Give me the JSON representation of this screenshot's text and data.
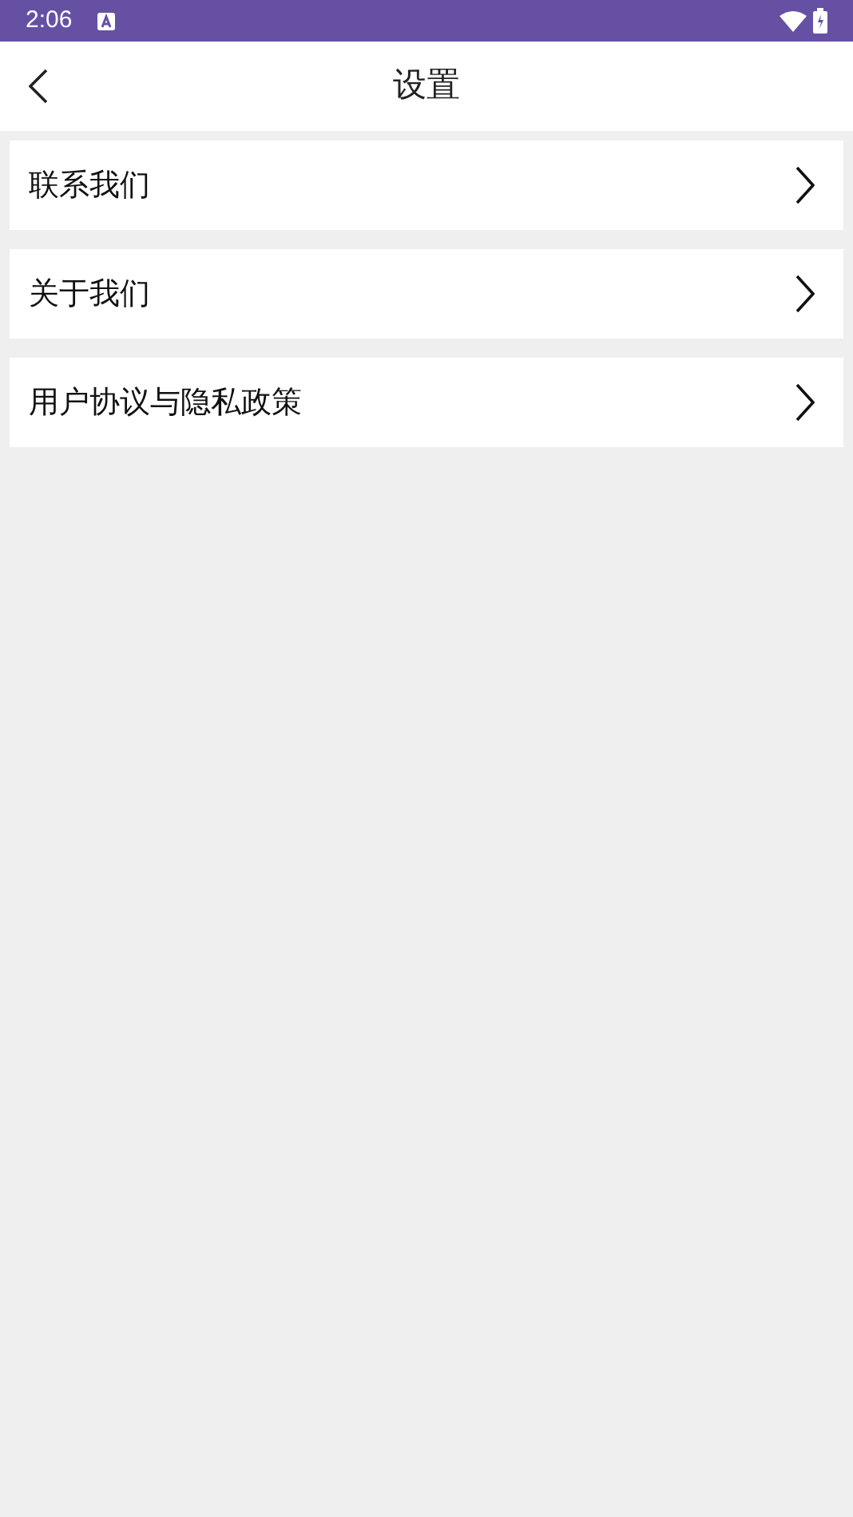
{
  "status_bar": {
    "time": "2:06"
  },
  "header": {
    "title": "设置"
  },
  "menu_items": [
    {
      "label": "联系我们"
    },
    {
      "label": "关于我们"
    },
    {
      "label": "用户协议与隐私政策"
    }
  ]
}
